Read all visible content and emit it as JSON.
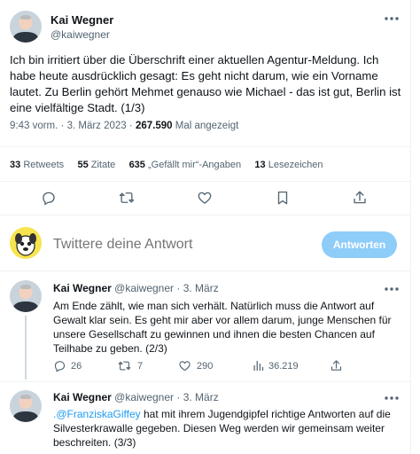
{
  "main_tweet": {
    "author_name": "Kai Wegner",
    "author_handle": "@kaiwegner",
    "text": "Ich bin irritiert über die Überschrift einer aktuellen Agentur-Meldung. Ich habe heute ausdrücklich gesagt: Es geht nicht darum, wie ein Vorname lautet. Zu Berlin gehört Mehmet genauso wie Michael - das ist gut, Berlin ist eine vielfältige Stadt. (1/3)",
    "time": "9:43 vorm.",
    "separator": "·",
    "date": "3. März 2023",
    "views_count": "267.590",
    "views_label": "Mal angezeigt",
    "stats": {
      "retweets_count": "33",
      "retweets_label": "Retweets",
      "quotes_count": "55",
      "quotes_label": "Zitate",
      "likes_count": "635",
      "likes_label": "„Gefällt mir“-Angaben",
      "bookmarks_count": "13",
      "bookmarks_label": "Lesezeichen"
    }
  },
  "composer": {
    "placeholder": "Twittere deine Antwort",
    "reply_button": "Antworten"
  },
  "replies": [
    {
      "author_name": "Kai Wegner",
      "author_handle": "@kaiwegner",
      "dot": "·",
      "date": "3. März",
      "text": "Am Ende zählt, wie man sich verhält. Natürlich muss die Antwort auf Gewalt klar sein. Es geht mir aber vor allem darum, junge Menschen für unsere Gesellschaft zu gewinnen und ihnen die besten Chancen auf Teilhabe zu geben. (2/3)",
      "reply_count": "26",
      "retweet_count": "7",
      "like_count": "290",
      "views_count": "36.219"
    },
    {
      "author_name": "Kai Wegner",
      "author_handle": "@kaiwegner",
      "dot": "·",
      "date": "3. März",
      "mention": ".@FranziskaGiffey",
      "text": " hat mit ihrem Jugendgipfel richtige Antworten auf die Silvesterkrawalle gegeben. Diesen Weg werden wir gemeinsam weiter beschreiten. (3/3)"
    }
  ],
  "icons": {
    "more": "more-icon",
    "reply": "reply-icon",
    "retweet": "retweet-icon",
    "like": "heart-icon",
    "bookmark": "bookmark-icon",
    "share": "share-icon",
    "views": "views-icon"
  },
  "colors": {
    "accent": "#1d9bf0",
    "reply_button_disabled": "#8ecdf8",
    "muted": "#536471",
    "text": "#0f1419"
  }
}
